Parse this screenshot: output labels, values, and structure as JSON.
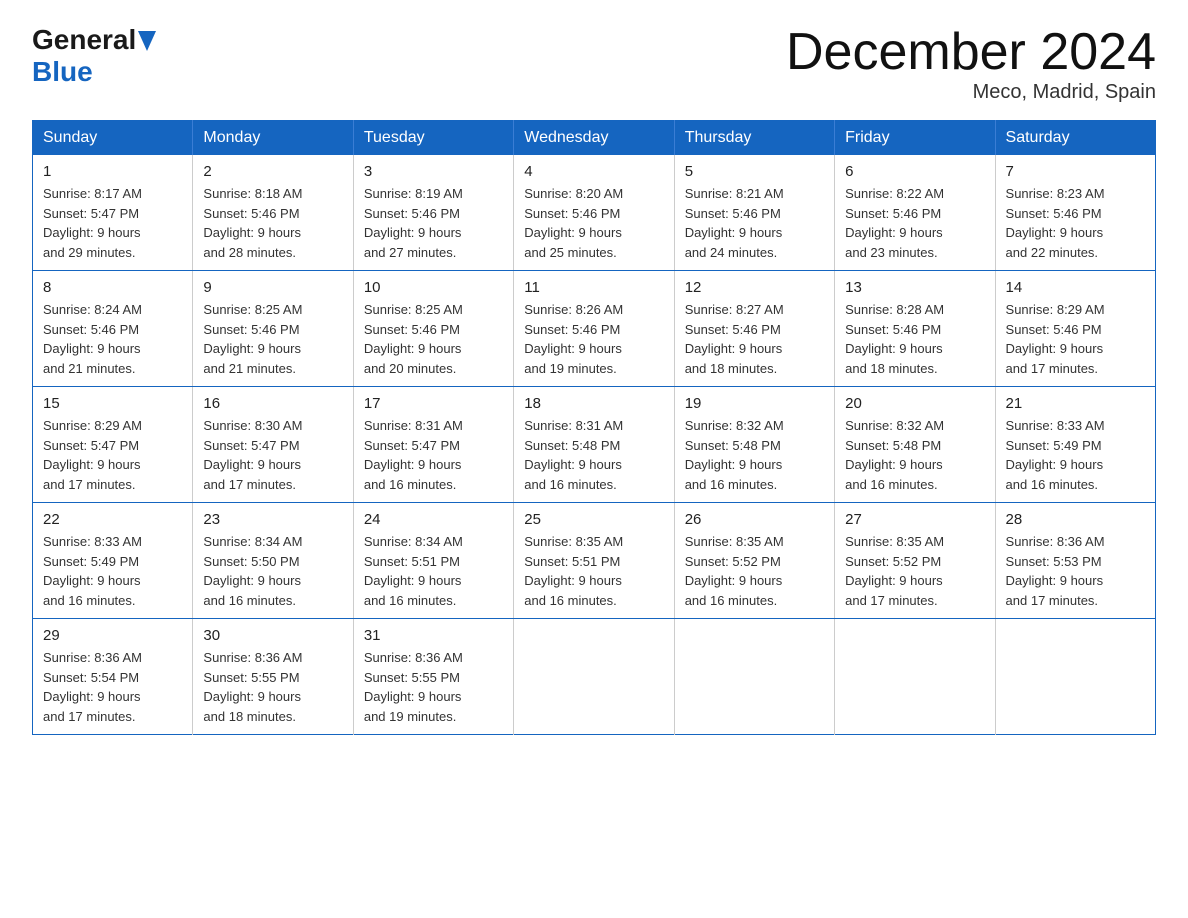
{
  "header": {
    "title": "December 2024",
    "location": "Meco, Madrid, Spain"
  },
  "weekdays": [
    "Sunday",
    "Monday",
    "Tuesday",
    "Wednesday",
    "Thursday",
    "Friday",
    "Saturday"
  ],
  "weeks": [
    [
      {
        "day": "1",
        "sunrise": "8:17 AM",
        "sunset": "5:47 PM",
        "daylight": "9 hours and 29 minutes."
      },
      {
        "day": "2",
        "sunrise": "8:18 AM",
        "sunset": "5:46 PM",
        "daylight": "9 hours and 28 minutes."
      },
      {
        "day": "3",
        "sunrise": "8:19 AM",
        "sunset": "5:46 PM",
        "daylight": "9 hours and 27 minutes."
      },
      {
        "day": "4",
        "sunrise": "8:20 AM",
        "sunset": "5:46 PM",
        "daylight": "9 hours and 25 minutes."
      },
      {
        "day": "5",
        "sunrise": "8:21 AM",
        "sunset": "5:46 PM",
        "daylight": "9 hours and 24 minutes."
      },
      {
        "day": "6",
        "sunrise": "8:22 AM",
        "sunset": "5:46 PM",
        "daylight": "9 hours and 23 minutes."
      },
      {
        "day": "7",
        "sunrise": "8:23 AM",
        "sunset": "5:46 PM",
        "daylight": "9 hours and 22 minutes."
      }
    ],
    [
      {
        "day": "8",
        "sunrise": "8:24 AM",
        "sunset": "5:46 PM",
        "daylight": "9 hours and 21 minutes."
      },
      {
        "day": "9",
        "sunrise": "8:25 AM",
        "sunset": "5:46 PM",
        "daylight": "9 hours and 21 minutes."
      },
      {
        "day": "10",
        "sunrise": "8:25 AM",
        "sunset": "5:46 PM",
        "daylight": "9 hours and 20 minutes."
      },
      {
        "day": "11",
        "sunrise": "8:26 AM",
        "sunset": "5:46 PM",
        "daylight": "9 hours and 19 minutes."
      },
      {
        "day": "12",
        "sunrise": "8:27 AM",
        "sunset": "5:46 PM",
        "daylight": "9 hours and 18 minutes."
      },
      {
        "day": "13",
        "sunrise": "8:28 AM",
        "sunset": "5:46 PM",
        "daylight": "9 hours and 18 minutes."
      },
      {
        "day": "14",
        "sunrise": "8:29 AM",
        "sunset": "5:46 PM",
        "daylight": "9 hours and 17 minutes."
      }
    ],
    [
      {
        "day": "15",
        "sunrise": "8:29 AM",
        "sunset": "5:47 PM",
        "daylight": "9 hours and 17 minutes."
      },
      {
        "day": "16",
        "sunrise": "8:30 AM",
        "sunset": "5:47 PM",
        "daylight": "9 hours and 17 minutes."
      },
      {
        "day": "17",
        "sunrise": "8:31 AM",
        "sunset": "5:47 PM",
        "daylight": "9 hours and 16 minutes."
      },
      {
        "day": "18",
        "sunrise": "8:31 AM",
        "sunset": "5:48 PM",
        "daylight": "9 hours and 16 minutes."
      },
      {
        "day": "19",
        "sunrise": "8:32 AM",
        "sunset": "5:48 PM",
        "daylight": "9 hours and 16 minutes."
      },
      {
        "day": "20",
        "sunrise": "8:32 AM",
        "sunset": "5:48 PM",
        "daylight": "9 hours and 16 minutes."
      },
      {
        "day": "21",
        "sunrise": "8:33 AM",
        "sunset": "5:49 PM",
        "daylight": "9 hours and 16 minutes."
      }
    ],
    [
      {
        "day": "22",
        "sunrise": "8:33 AM",
        "sunset": "5:49 PM",
        "daylight": "9 hours and 16 minutes."
      },
      {
        "day": "23",
        "sunrise": "8:34 AM",
        "sunset": "5:50 PM",
        "daylight": "9 hours and 16 minutes."
      },
      {
        "day": "24",
        "sunrise": "8:34 AM",
        "sunset": "5:51 PM",
        "daylight": "9 hours and 16 minutes."
      },
      {
        "day": "25",
        "sunrise": "8:35 AM",
        "sunset": "5:51 PM",
        "daylight": "9 hours and 16 minutes."
      },
      {
        "day": "26",
        "sunrise": "8:35 AM",
        "sunset": "5:52 PM",
        "daylight": "9 hours and 16 minutes."
      },
      {
        "day": "27",
        "sunrise": "8:35 AM",
        "sunset": "5:52 PM",
        "daylight": "9 hours and 17 minutes."
      },
      {
        "day": "28",
        "sunrise": "8:36 AM",
        "sunset": "5:53 PM",
        "daylight": "9 hours and 17 minutes."
      }
    ],
    [
      {
        "day": "29",
        "sunrise": "8:36 AM",
        "sunset": "5:54 PM",
        "daylight": "9 hours and 17 minutes."
      },
      {
        "day": "30",
        "sunrise": "8:36 AM",
        "sunset": "5:55 PM",
        "daylight": "9 hours and 18 minutes."
      },
      {
        "day": "31",
        "sunrise": "8:36 AM",
        "sunset": "5:55 PM",
        "daylight": "9 hours and 19 minutes."
      },
      null,
      null,
      null,
      null
    ]
  ],
  "labels": {
    "sunrise": "Sunrise:",
    "sunset": "Sunset:",
    "daylight": "Daylight:"
  }
}
